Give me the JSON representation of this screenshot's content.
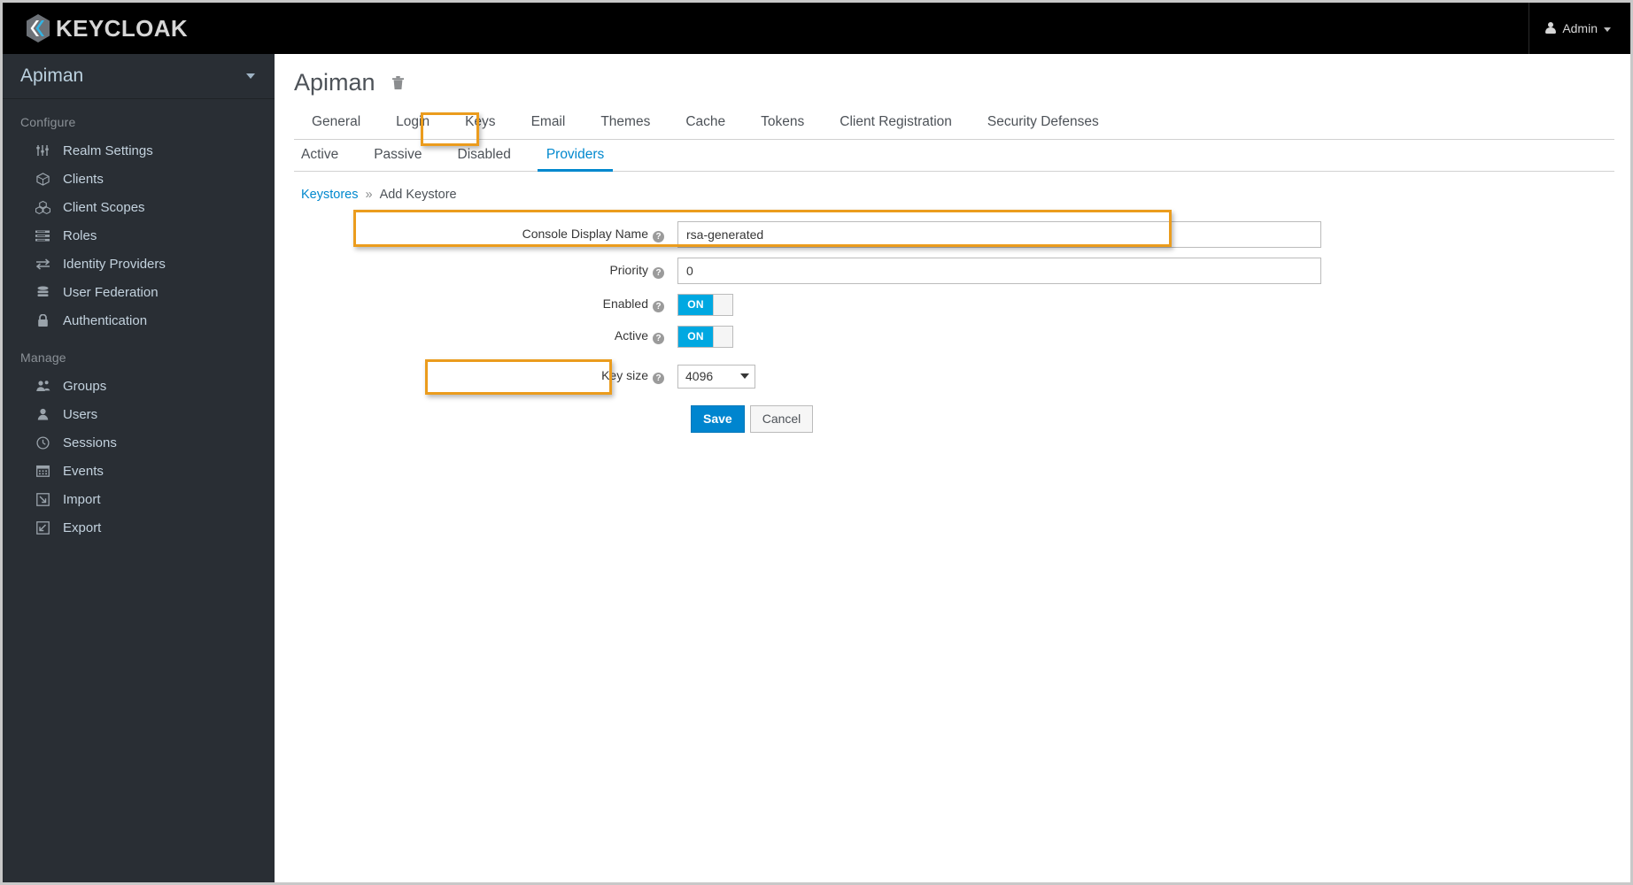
{
  "masthead": {
    "brand_name": "KEYCLOAK",
    "brand_logo_icon": "keycloak-logo-icon",
    "user_label": "Admin",
    "user_icon": "person-icon",
    "user_caret_icon": "chevron-down-icon"
  },
  "sidebar": {
    "realm_name": "Apiman",
    "realm_caret_icon": "chevron-down-icon",
    "sections": [
      {
        "label": "Configure",
        "items": [
          {
            "label": "Realm Settings",
            "icon": "sliders-icon"
          },
          {
            "label": "Clients",
            "icon": "cube-icon"
          },
          {
            "label": "Client Scopes",
            "icon": "cubes-icon"
          },
          {
            "label": "Roles",
            "icon": "list-bars-icon"
          },
          {
            "label": "Identity Providers",
            "icon": "exchange-arrows-icon"
          },
          {
            "label": "User Federation",
            "icon": "database-icon"
          },
          {
            "label": "Authentication",
            "icon": "lock-icon"
          }
        ]
      },
      {
        "label": "Manage",
        "items": [
          {
            "label": "Groups",
            "icon": "users-group-icon"
          },
          {
            "label": "Users",
            "icon": "user-icon"
          },
          {
            "label": "Sessions",
            "icon": "clock-icon"
          },
          {
            "label": "Events",
            "icon": "calendar-icon"
          },
          {
            "label": "Import",
            "icon": "import-arrow-icon"
          },
          {
            "label": "Export",
            "icon": "export-arrow-icon"
          }
        ]
      }
    ]
  },
  "main": {
    "page_title": "Apiman",
    "delete_icon": "trash-icon",
    "primary_tabs": [
      {
        "label": "General",
        "active": false
      },
      {
        "label": "Login",
        "active": false
      },
      {
        "label": "Keys",
        "active": false
      },
      {
        "label": "Email",
        "active": false
      },
      {
        "label": "Themes",
        "active": false
      },
      {
        "label": "Cache",
        "active": false
      },
      {
        "label": "Tokens",
        "active": false
      },
      {
        "label": "Client Registration",
        "active": false
      },
      {
        "label": "Security Defenses",
        "active": false
      }
    ],
    "secondary_tabs": [
      {
        "label": "Active",
        "active": false
      },
      {
        "label": "Passive",
        "active": false
      },
      {
        "label": "Disabled",
        "active": false
      },
      {
        "label": "Providers",
        "active": true
      }
    ],
    "breadcrumb": {
      "root_label": "Keystores",
      "separator": "»",
      "current_label": "Add Keystore"
    },
    "form": {
      "console_display_name": {
        "label": "Console Display Name",
        "value": "rsa-generated",
        "help_icon": "question-circle-icon"
      },
      "priority": {
        "label": "Priority",
        "value": "0",
        "help_icon": "question-circle-icon"
      },
      "enabled": {
        "label": "Enabled",
        "state": "ON",
        "help_icon": "question-circle-icon"
      },
      "active": {
        "label": "Active",
        "state": "ON",
        "help_icon": "question-circle-icon"
      },
      "key_size": {
        "label": "Key size",
        "value": "4096",
        "help_icon": "question-circle-icon",
        "caret_icon": "caret-down-icon"
      },
      "save_label": "Save",
      "cancel_label": "Cancel"
    }
  },
  "annotations": {
    "highlight_color": "#eb9c1d",
    "targets": [
      "providers-tab",
      "console-display-name-row",
      "key-size-row"
    ]
  },
  "colors": {
    "masthead_bg": "#000000",
    "sidebar_bg": "#292e34",
    "accent_blue": "#0088ce",
    "toggle_on": "#00a8e1",
    "primary_button": "#0085cf"
  }
}
